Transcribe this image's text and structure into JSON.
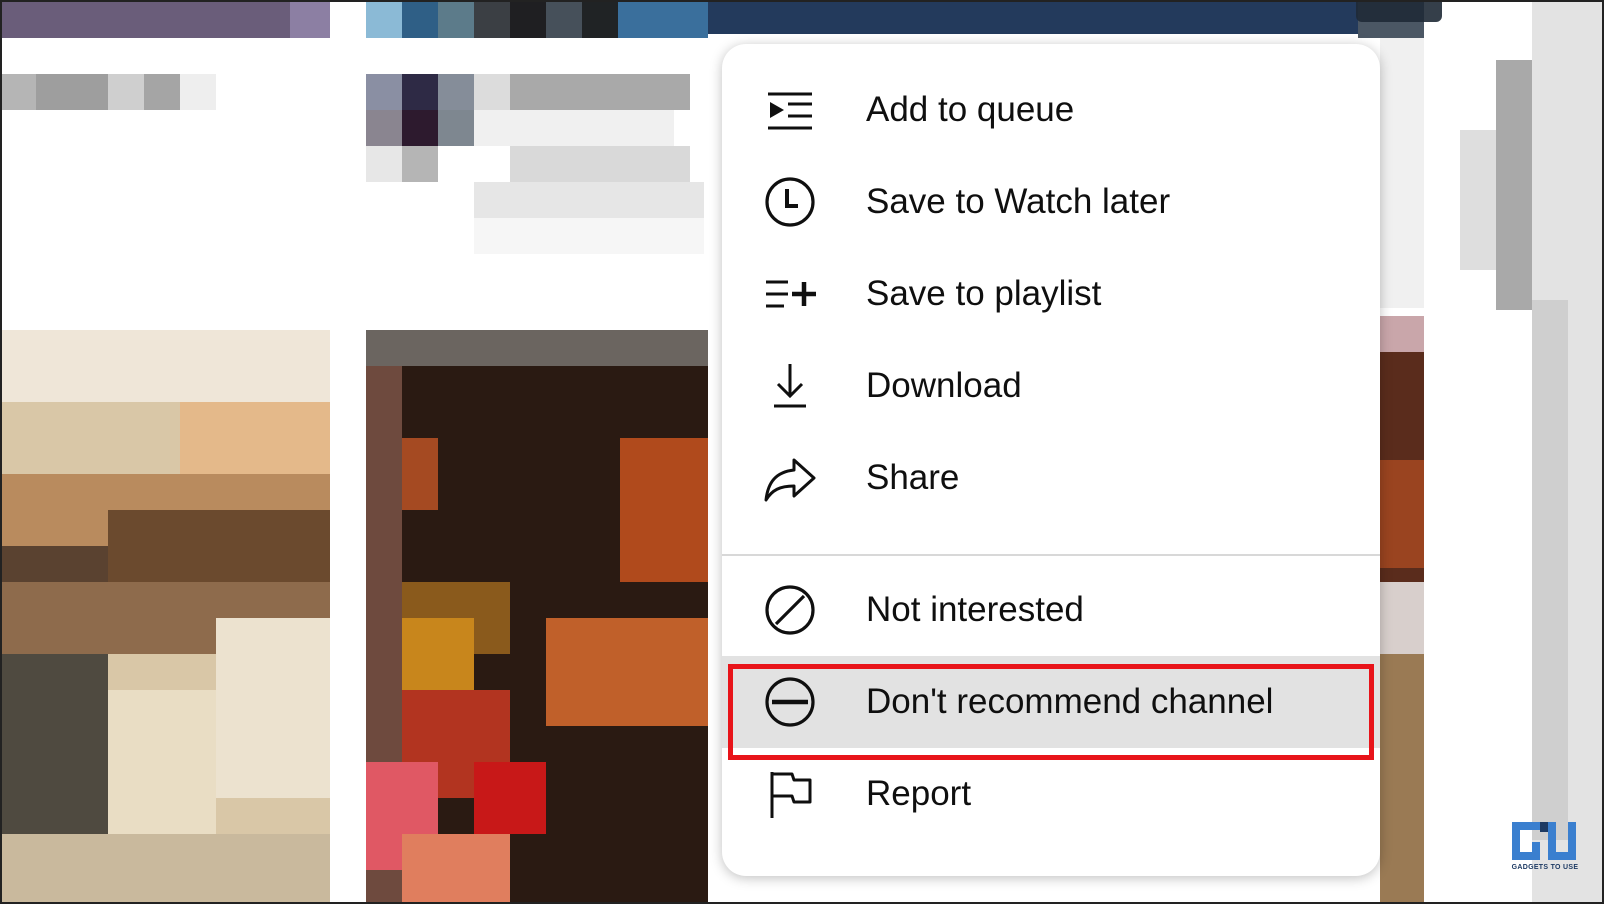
{
  "menu": {
    "items": [
      {
        "label": "Add to queue",
        "icon": "add-to-queue-icon"
      },
      {
        "label": "Save to Watch later",
        "icon": "clock-icon"
      },
      {
        "label": "Save to playlist",
        "icon": "playlist-add-icon"
      },
      {
        "label": "Download",
        "icon": "download-icon"
      },
      {
        "label": "Share",
        "icon": "share-arrow-icon"
      },
      {
        "label": "Not interested",
        "icon": "not-interested-icon"
      },
      {
        "label": "Don't recommend channel",
        "icon": "minus-circle-icon",
        "selected": true
      },
      {
        "label": "Report",
        "icon": "flag-icon"
      }
    ]
  },
  "colors": {
    "highlight_border": "#e8141a",
    "selected_row": "#e2e2e2",
    "menu_background": "#ffffff",
    "text": "#0f0f0f"
  },
  "watermark": {
    "text": "GADGETS TO USE"
  }
}
